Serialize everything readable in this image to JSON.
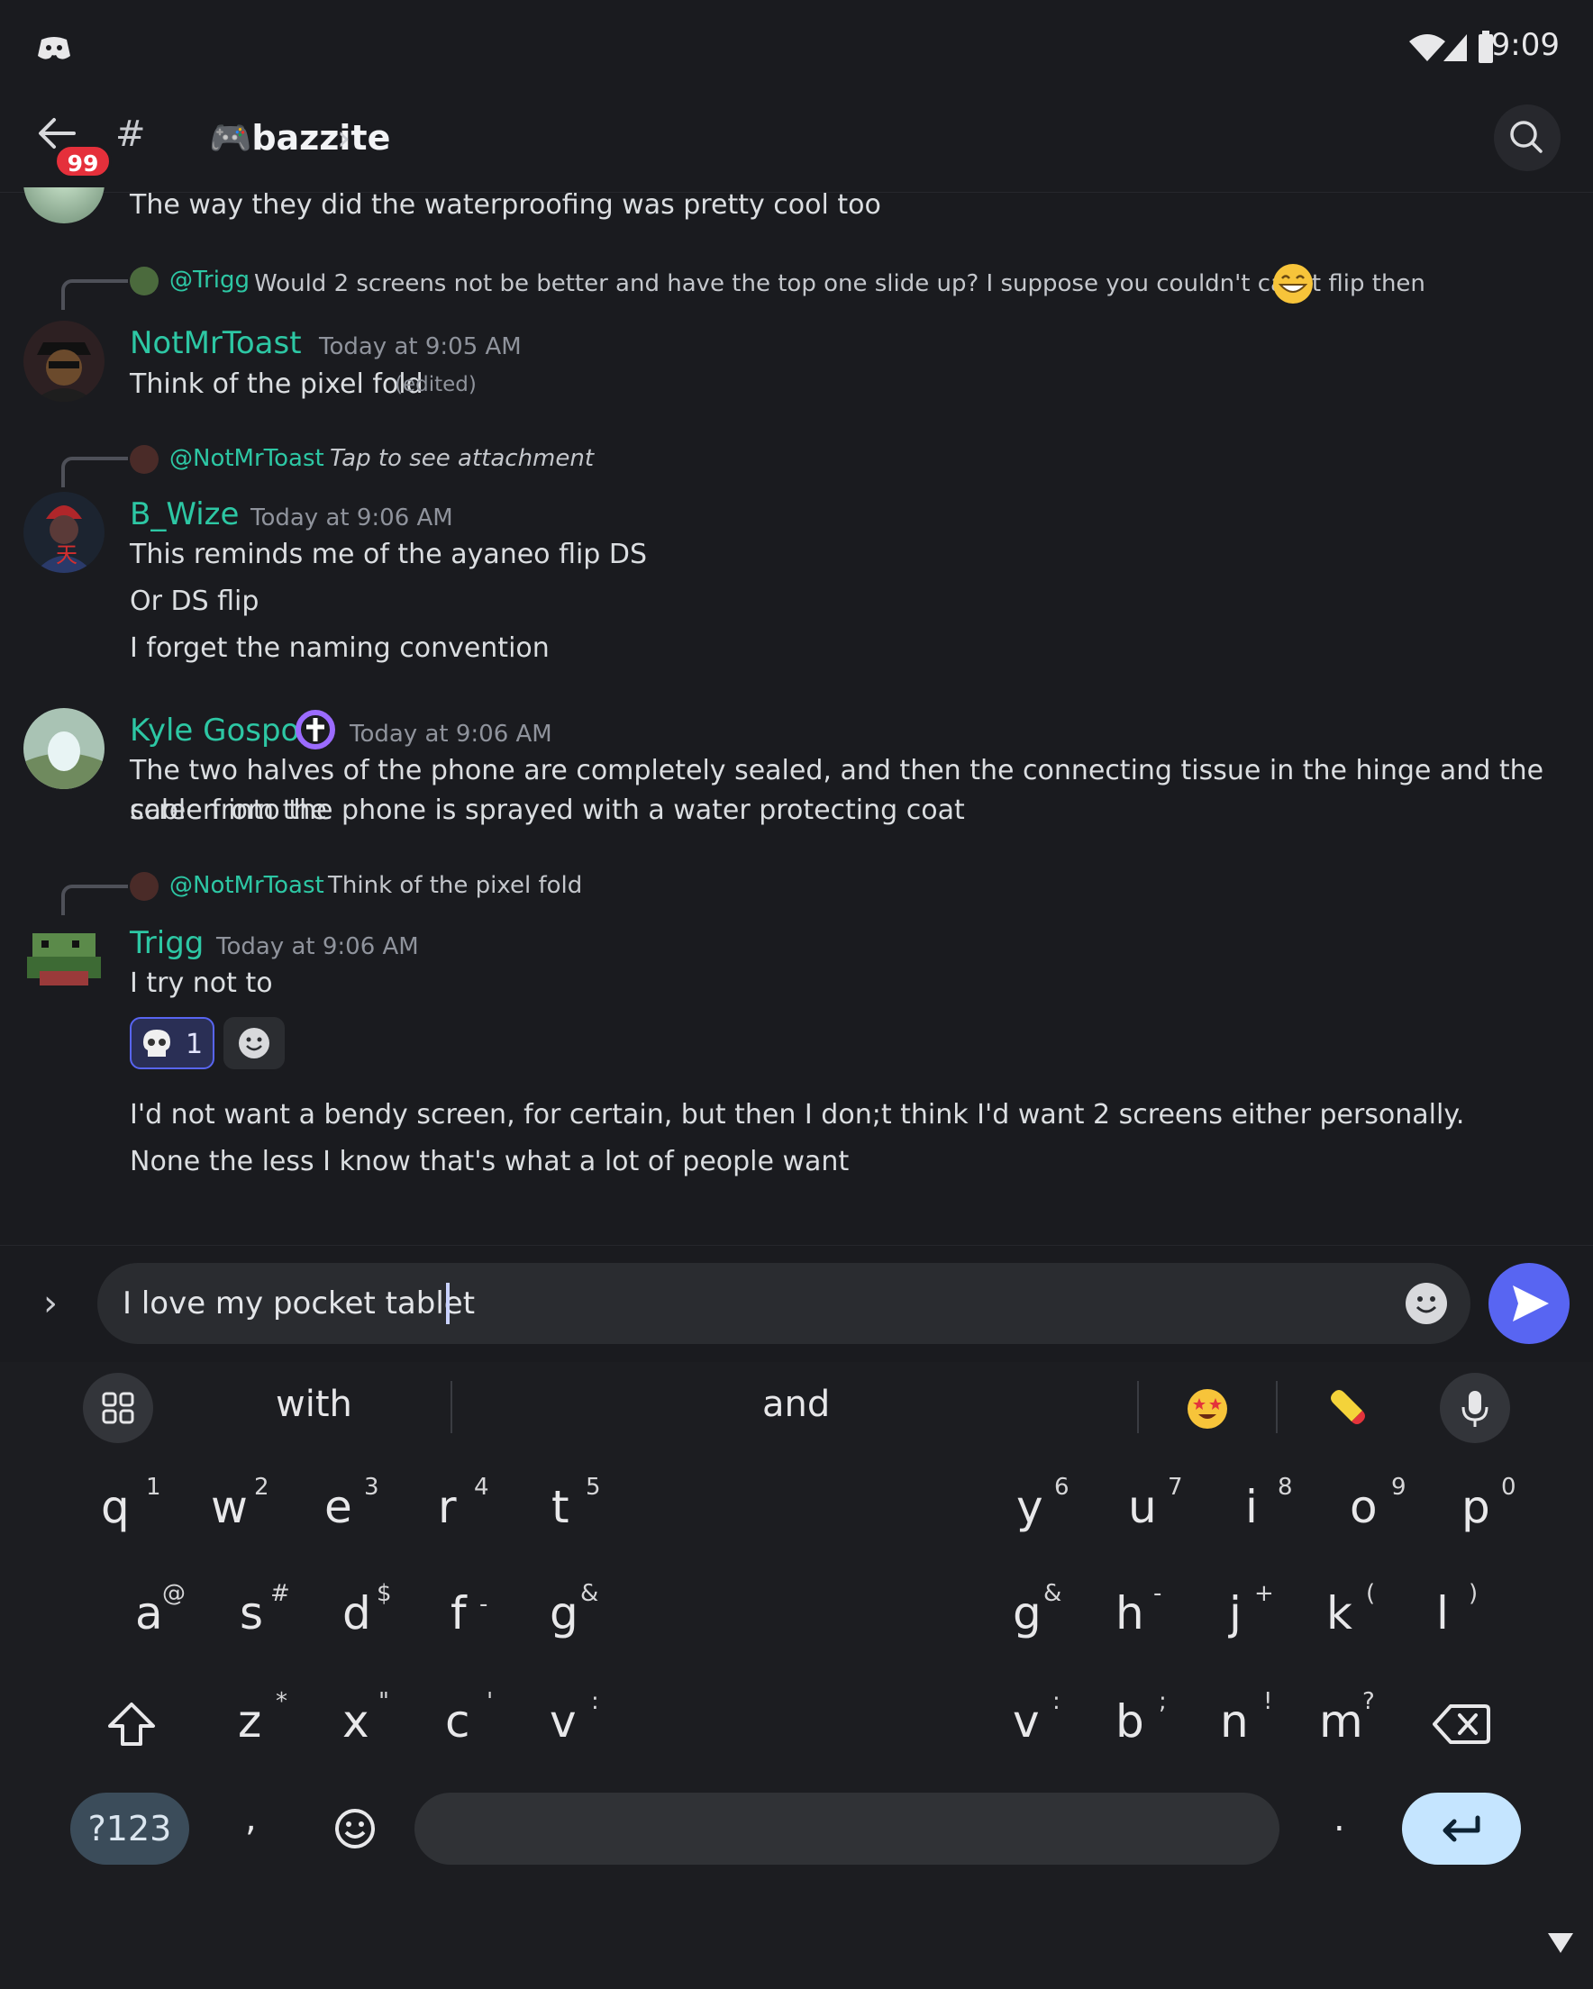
{
  "status_bar": {
    "time": "9:09"
  },
  "header": {
    "unread_badge": "99",
    "hash_symbol": "#",
    "channel_name": "🎮bazzite",
    "chevron": "›"
  },
  "messages": [
    {
      "text": "The way they did the waterproofing was pretty cool too"
    },
    {
      "reply": {
        "name": "@Trigg",
        "text": "Would 2 screens not be better and have the top one slide up? I suppose you couldn't call it flip then"
      },
      "author": "NotMrToast",
      "timestamp": "Today at 9:05 AM",
      "lines": [
        "Think of the pixel fold"
      ],
      "edited": "(edited)"
    },
    {
      "reply": {
        "name": "@NotMrToast",
        "text": "Tap to see attachment"
      },
      "author": "B_Wize",
      "timestamp": "Today at 9:06 AM",
      "lines": [
        "This reminds me of the ayaneo flip DS",
        "Or DS flip",
        "I forget the naming convention"
      ]
    },
    {
      "author": "Kyle Gospo",
      "timestamp": "Today at 9:06 AM",
      "lines": [
        "The two halves of the phone are completely sealed, and then the connecting tissue in the hinge and the cable from the",
        "screen into the phone is sprayed with a water protecting coat"
      ]
    },
    {
      "reply": {
        "name": "@NotMrToast",
        "text": "Think of the pixel fold"
      },
      "author": "Trigg",
      "timestamp": "Today at 9:06 AM",
      "lines": [
        "I try not to"
      ],
      "reaction": {
        "emoji": "skull",
        "count": "1"
      },
      "more_lines": [
        "I'd not want a bendy screen, for certain, but then I don;t think I'd want 2 screens either personally.",
        "None the less I know that's what a lot of people want"
      ]
    }
  ],
  "composer": {
    "value": "I love my pocket tablet",
    "expand": "›"
  },
  "keyboard": {
    "suggestions": [
      "with",
      "and"
    ],
    "row1": [
      [
        "q",
        "1"
      ],
      [
        "w",
        "2"
      ],
      [
        "e",
        "3"
      ],
      [
        "r",
        "4"
      ],
      [
        "t",
        "5"
      ],
      [
        "y",
        "6"
      ],
      [
        "u",
        "7"
      ],
      [
        "i",
        "8"
      ],
      [
        "o",
        "9"
      ],
      [
        "p",
        "0"
      ]
    ],
    "row2": [
      [
        "a",
        "@"
      ],
      [
        "s",
        "#"
      ],
      [
        "d",
        "$"
      ],
      [
        "f",
        "-"
      ],
      [
        "g",
        "&"
      ],
      [
        "g",
        "&"
      ],
      [
        "h",
        "-"
      ],
      [
        "j",
        "+"
      ],
      [
        "k",
        "("
      ],
      [
        "l",
        ")"
      ]
    ],
    "row3": [
      [
        "z",
        "*"
      ],
      [
        "x",
        "\""
      ],
      [
        "c",
        "'"
      ],
      [
        "v",
        ":"
      ],
      [
        "v",
        ":"
      ],
      [
        "b",
        ";"
      ],
      [
        "n",
        "!"
      ],
      [
        "m",
        "?"
      ]
    ],
    "symbols_key": "?123",
    "comma": ",",
    "period": "."
  },
  "colors": {
    "accent": "#5865f2",
    "username": "#2dc7a4",
    "background": "#1a1b1f",
    "badge": "#e5303b"
  }
}
